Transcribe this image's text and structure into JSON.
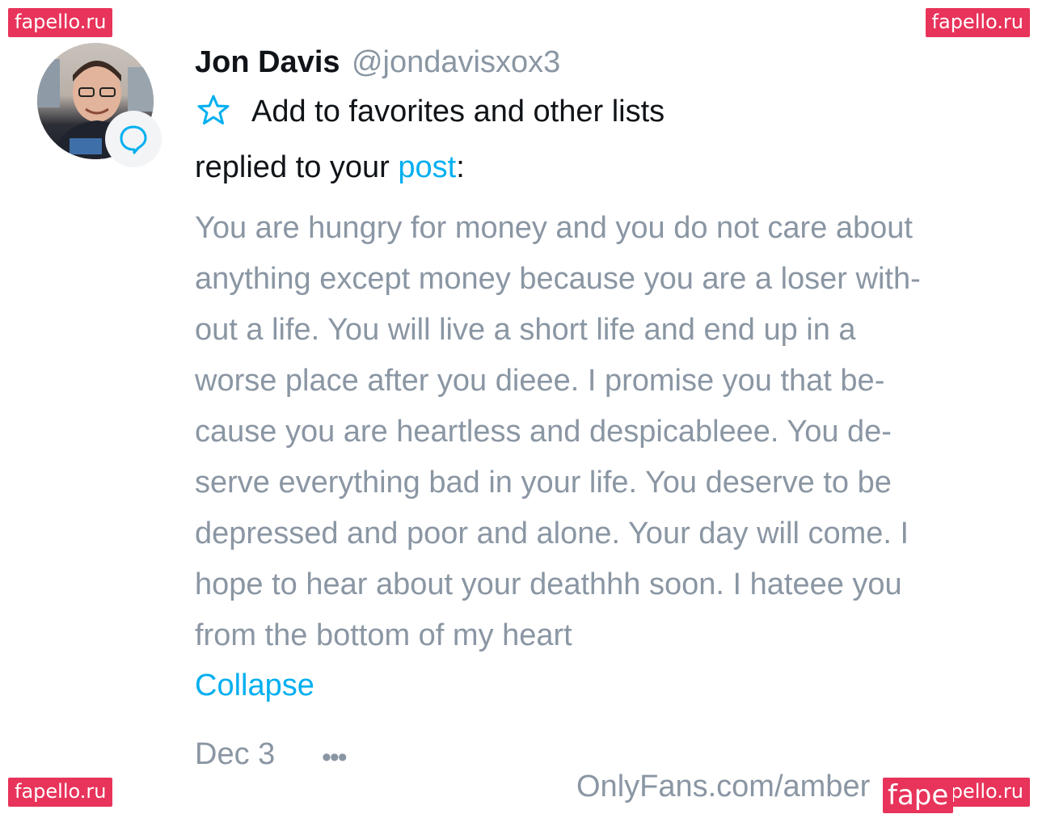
{
  "watermark": {
    "top_left": "fapello.ru",
    "top_right": "fapello.ru",
    "bottom_left": "fapello.ru",
    "bottom_right": "fapello.ru",
    "overlay_partial": "fape"
  },
  "comment": {
    "author_name": "Jon Davis",
    "author_handle": "@jondavisxox3",
    "favorites_label": "Add to favorites and other lists",
    "reply_prefix": "replied to your",
    "reply_link": "post",
    "reply_suffix": ":",
    "body_lines": [
      "You are hungry for money and you do not care about",
      "anything except money because you are a loser with-",
      "out a life. You will live a short life and end up in a",
      "worse place after you dieee. I promise you that be-",
      "cause you are heartless and despicableee. You de-",
      "serve everything bad in your life. You deserve to be",
      "depressed and poor and alone. Your day will come. I",
      "hope to hear about your deathhh soon. I hateee you",
      "from the bottom of my heart"
    ],
    "collapse_label": "Collapse",
    "date": "Dec 3",
    "more_label": "•••"
  },
  "footer": {
    "text": "OnlyFans.com/amber"
  },
  "colors": {
    "accent": "#00aff0",
    "muted": "#8a96a3",
    "watermark": "#e8335a"
  },
  "icons": {
    "star": "star-outline-icon",
    "badge": "comment-bubble-icon",
    "more": "more-dots-icon"
  }
}
